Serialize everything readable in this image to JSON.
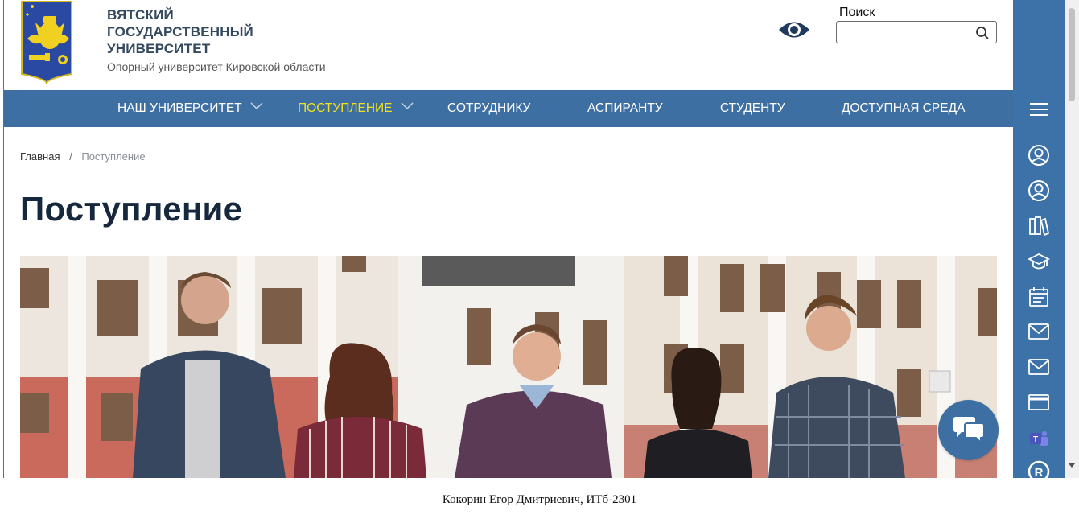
{
  "header": {
    "university_name_lines": [
      "ВЯТСКИЙ",
      "ГОСУДАРСТВЕННЫЙ",
      "УНИВЕРСИТЕТ"
    ],
    "subtitle": "Опорный университет Кировской области",
    "logo_icon": "university-crest-icon",
    "accessibility_icon": "eye-icon",
    "search": {
      "label": "Поиск",
      "value": "",
      "placeholder": ""
    }
  },
  "nav": {
    "items": [
      {
        "label": "НАШ УНИВЕРСИТЕТ",
        "has_dropdown": true,
        "active": false
      },
      {
        "label": "ПОСТУПЛЕНИЕ",
        "has_dropdown": true,
        "active": true
      },
      {
        "label": "СОТРУДНИКУ",
        "has_dropdown": false,
        "active": false
      },
      {
        "label": "АСПИРАНТУ",
        "has_dropdown": false,
        "active": false
      },
      {
        "label": "СТУДЕНТУ",
        "has_dropdown": false,
        "active": false
      },
      {
        "label": "ДОСТУПНАЯ СРЕДА",
        "has_dropdown": false,
        "active": false
      }
    ]
  },
  "breadcrumb": {
    "home": "Главная",
    "separator": "/",
    "current": "Поступление"
  },
  "page": {
    "title": "Поступление"
  },
  "rail": {
    "icons": [
      "hamburger-menu-icon",
      "user-profile-icon",
      "user-account-icon",
      "library-books-icon",
      "graduation-cap-icon",
      "calendar-icon",
      "mail-icon",
      "mail-alt-icon",
      "payment-card-icon",
      "ms-teams-icon",
      "r-logo-icon"
    ]
  },
  "chat": {
    "icon": "chat-bubbles-icon"
  },
  "caption": "Кокорин Егор Дмитриевич, ИТб-2301",
  "colors": {
    "nav_bg": "#3d6fa3",
    "nav_active": "#f5e11a",
    "rail_bg": "#3d72a8",
    "title": "#16283d",
    "brand_text": "#34495e"
  }
}
